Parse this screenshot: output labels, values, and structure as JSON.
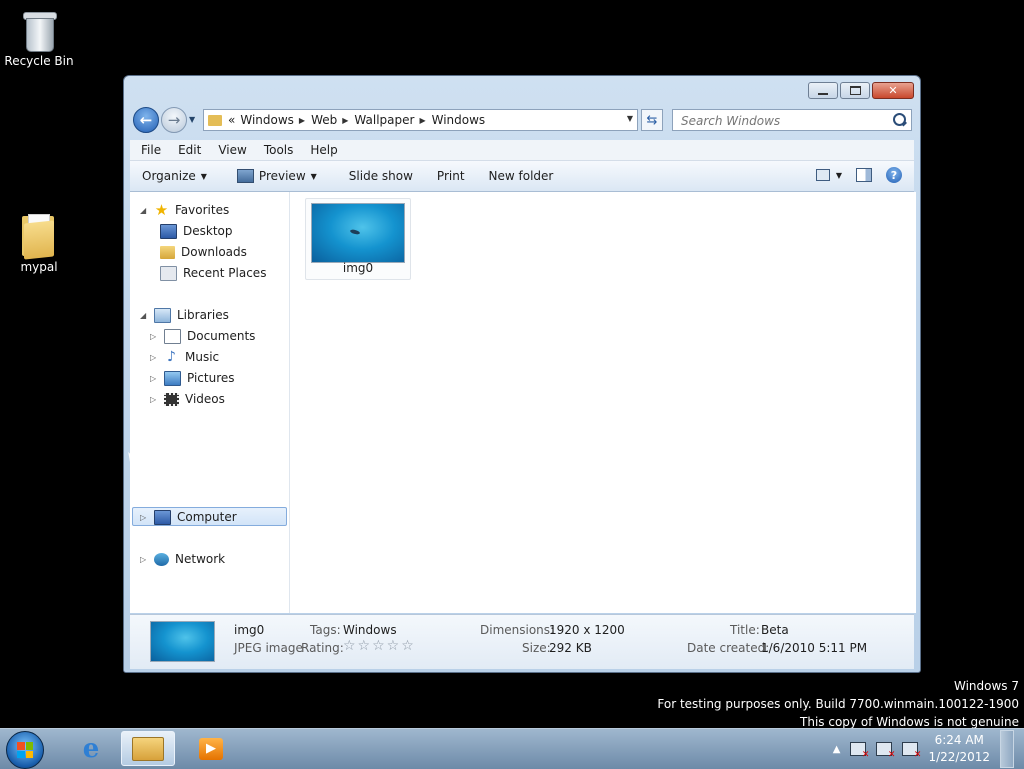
{
  "desktop": {
    "icons": [
      {
        "label": "Recycle Bin",
        "icon": "recycle-bin-icon"
      },
      {
        "label": "mypal",
        "icon": "folder-icon"
      }
    ]
  },
  "window": {
    "address": {
      "overflow": "«",
      "crumbs": [
        "Windows",
        "Web",
        "Wallpaper",
        "Windows"
      ]
    },
    "search_placeholder": "Search Windows",
    "menu": [
      "File",
      "Edit",
      "View",
      "Tools",
      "Help"
    ],
    "commands": {
      "organize": "Organize",
      "preview": "Preview",
      "slideshow": "Slide show",
      "print": "Print",
      "new_folder": "New folder"
    },
    "nav": {
      "favorites": "Favorites",
      "desktop": "Desktop",
      "downloads": "Downloads",
      "recent": "Recent Places",
      "libraries": "Libraries",
      "documents": "Documents",
      "music": "Music",
      "pictures": "Pictures",
      "videos": "Videos",
      "computer": "Computer",
      "network": "Network"
    },
    "files": [
      {
        "name": "img0"
      }
    ],
    "details": {
      "name": "img0",
      "type": "JPEG image",
      "tags_label": "Tags:",
      "tags": "Windows",
      "rating_label": "Rating:",
      "rating_stars": "☆☆☆☆☆",
      "dimensions_label": "Dimensions:",
      "dimensions": "1920 x 1200",
      "size_label": "Size:",
      "size": "292 KB",
      "title_label": "Title:",
      "title": "Beta",
      "created_label": "Date created:",
      "created": "1/6/2010 5:11 PM"
    }
  },
  "watermark": {
    "line1": "Windows 7",
    "line2": "For testing purposes only. Build 7700.winmain.100122-1900",
    "line3": "This copy of Windows is not genuine"
  },
  "taskbar": {
    "time": "6:24 AM",
    "date": "1/22/2012"
  },
  "colors": {
    "window_frame": "#c1d6ec",
    "selection": "#d2e4f8",
    "close_button": "#c9482d",
    "taskbar": "#6d8aa8"
  }
}
